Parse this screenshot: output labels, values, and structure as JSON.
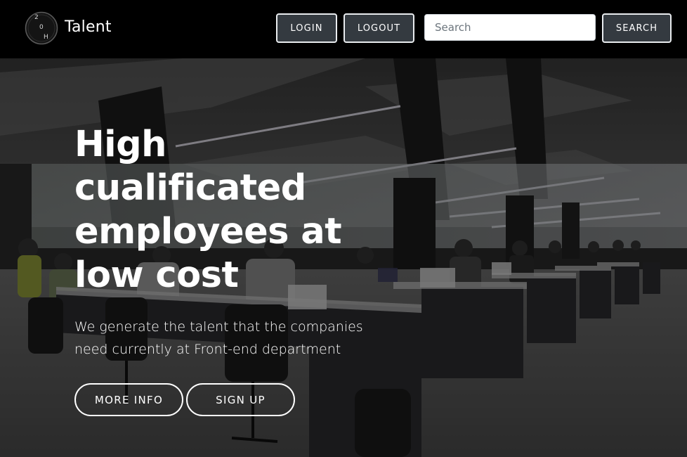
{
  "navbar": {
    "logo": {
      "icon": "h2o-logo-icon",
      "glyph_top": "2",
      "glyph_middle": "0",
      "glyph_bottom": "H"
    },
    "brand_name": "Talent",
    "login_label": "LOGIN",
    "logout_label": "LOGOUT",
    "search_placeholder": "Search",
    "search_value": "",
    "search_button_label": "SEARCH"
  },
  "hero": {
    "background": "office-workspace-photo",
    "title": "High cualificated employees at low cost",
    "subtitle": "We generate the talent that the companies need currently at Front-end department",
    "more_info_label": "MORE INFO",
    "sign_up_label": "SIGN UP"
  },
  "colors": {
    "navbar_bg": "#000000",
    "nav_button_bg": "#343a40",
    "nav_button_border": "#e9ecef",
    "hero_text": "#ffffff"
  }
}
